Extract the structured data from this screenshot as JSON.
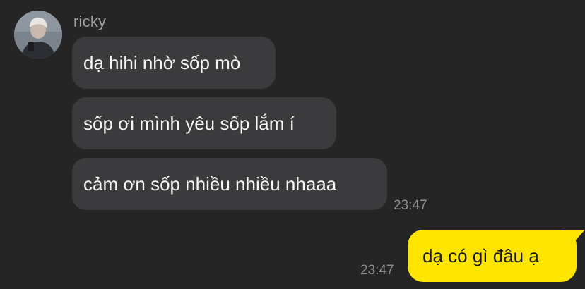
{
  "chat": {
    "sender": {
      "name": "ricky",
      "avatar_icon": "profile-photo"
    },
    "incoming_messages": [
      {
        "text": "dạ hihi nhờ sốp mò"
      },
      {
        "text": "sốp ơi mình yêu sốp lắm í"
      },
      {
        "text": "cảm ơn sốp nhiều nhiều nhaaa"
      }
    ],
    "incoming_time": "23:47",
    "outgoing_message": {
      "text": "dạ có gì đâu ạ"
    },
    "outgoing_time": "23:47"
  },
  "colors": {
    "background": "#252526",
    "incoming_bubble": "#3b3b3d",
    "outgoing_bubble": "#fee500",
    "timestamp": "#8e8e92"
  }
}
